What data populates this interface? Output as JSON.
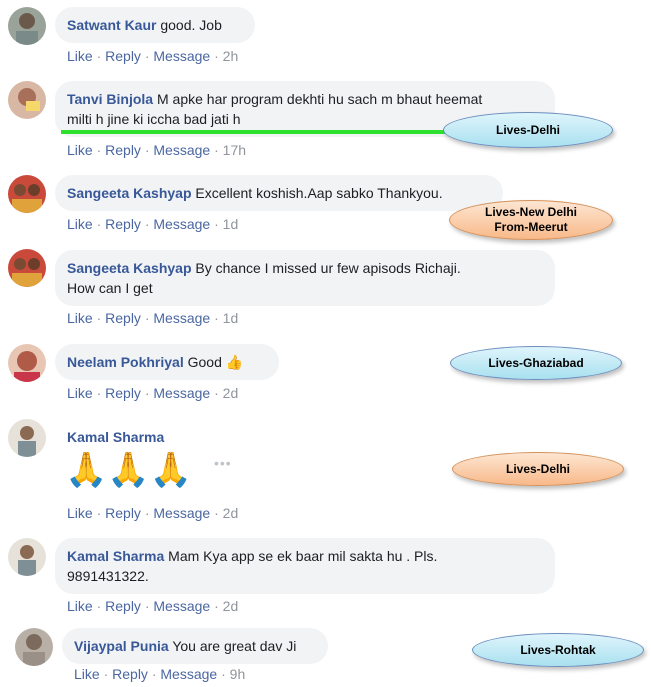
{
  "comments": [
    {
      "author": "Satwant Kaur",
      "text": "good. Job",
      "like": "Like",
      "reply": "Reply",
      "message": "Message",
      "time": "2h"
    },
    {
      "author": "Tanvi Binjola",
      "text_line1": "M apke har program dekhti hu sach m bhaut heemat",
      "text_line2": "milti h jine ki iccha bad jati h",
      "like": "Like",
      "reply": "Reply",
      "message": "Message",
      "time": "17h"
    },
    {
      "author": "Sangeeta Kashyap",
      "text": "Excellent koshish.Aap sabko Thankyou.",
      "like": "Like",
      "reply": "Reply",
      "message": "Message",
      "time": "1d"
    },
    {
      "author": "Sangeeta Kashyap",
      "text_line1": "By chance I missed ur few apisods Richaji.",
      "text_line2": "How can I get",
      "like": "Like",
      "reply": "Reply",
      "message": "Message",
      "time": "1d"
    },
    {
      "author": "Neelam Pokhriyal",
      "text": "Good",
      "emoji": "👍",
      "like": "Like",
      "reply": "Reply",
      "message": "Message",
      "time": "2d"
    },
    {
      "author": "Kamal Sharma",
      "emoji_row": "🙏🙏🙏",
      "more": "•••",
      "like": "Like",
      "reply": "Reply",
      "message": "Message",
      "time": "2d"
    },
    {
      "author": "Kamal Sharma",
      "text_line1": "Mam Kya app se ek baar mil sakta hu . Pls.",
      "text_line2": "9891431322.",
      "like": "Like",
      "reply": "Reply",
      "message": "Message",
      "time": "2d"
    },
    {
      "author": "Vijaypal Punia",
      "text": "You are great dav Ji",
      "like": "Like",
      "reply": "Reply",
      "message": "Message",
      "time": "9h"
    }
  ],
  "separator": "·",
  "annotations": [
    {
      "text": "Lives-Delhi",
      "color": "blue"
    },
    {
      "text_line1": "Lives-New Delhi",
      "text_line2": "From-Meerut",
      "color": "orange"
    },
    {
      "text": "Lives-Ghaziabad",
      "color": "blue"
    },
    {
      "text": "Lives-Delhi",
      "color": "orange"
    },
    {
      "text": "Lives-Rohtak",
      "color": "blue"
    }
  ],
  "colors": {
    "author": "#385898",
    "bubble": "#f2f3f5",
    "action_link": "#4b67a1",
    "highlight_line": "#2fe12f"
  }
}
